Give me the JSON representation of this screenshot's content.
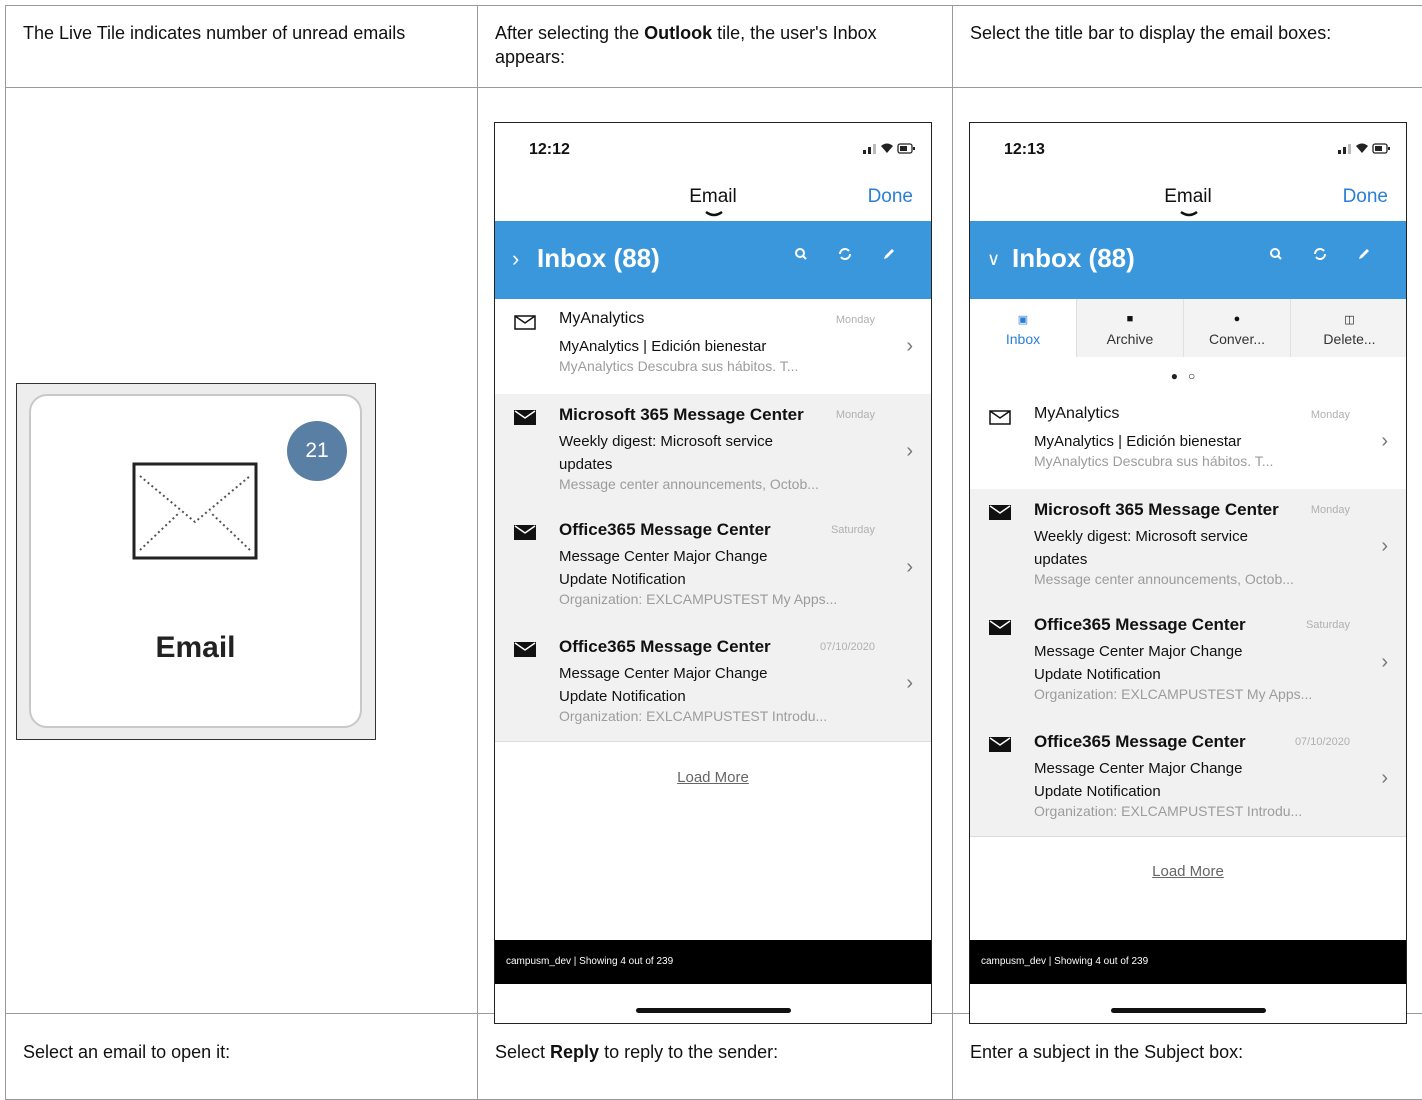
{
  "captions": {
    "c1": "The Live Tile indicates number of unread emails",
    "c2_pre": "After selecting the ",
    "c2_bold": "Outlook",
    "c2_post": " tile, the user's Inbox appears:",
    "c3": "Select the title bar to display the email boxes:",
    "c4": "Select an email to open it:",
    "c5_pre": "Select ",
    "c5_bold": "Reply",
    "c5_post": " to reply to the sender:",
    "c6": "Enter a subject in the Subject box:"
  },
  "tile": {
    "badge": "21",
    "label": "Email",
    "icon": "envelope-icon"
  },
  "phone1": {
    "time": "12:12",
    "header_title": "Email",
    "done": "Done",
    "inbox": "Inbox (88)",
    "load_more": "Load More",
    "footer": "campusm_dev | Showing 4 out of 239"
  },
  "phone2": {
    "time": "12:13",
    "header_title": "Email",
    "done": "Done",
    "inbox": "Inbox (88)",
    "folders": [
      "Inbox",
      "Archive",
      "Conver...",
      "Delete..."
    ],
    "load_more": "Load More",
    "footer": "campusm_dev | Showing 4 out of 239"
  },
  "emails": [
    {
      "sender": "MyAnalytics",
      "date": "Monday",
      "subject": "MyAnalytics | Edición bienestar",
      "preview": "MyAnalytics Descubra sus hábitos. T...",
      "unread": false
    },
    {
      "sender": "Microsoft 365 Message Center",
      "date": "Monday",
      "subject": "Weekly digest: Microsoft service updates",
      "preview": "Message center announcements, Octob...",
      "unread": true
    },
    {
      "sender": "Office365 Message Center",
      "date": "Saturday",
      "subject": "Message Center Major Change Update Notification",
      "preview": "Organization: EXLCAMPUSTEST My Apps...",
      "unread": true
    },
    {
      "sender": "Office365 Message Center",
      "date": "07/10/2020",
      "subject": "Message Center Major Change Update Notification",
      "preview": "Organization: EXLCAMPUSTEST Introdu...",
      "unread": true
    }
  ],
  "colors": {
    "bar": "#3a97dc",
    "done": "#2a7fd4",
    "badge": "#5a7fa5"
  }
}
